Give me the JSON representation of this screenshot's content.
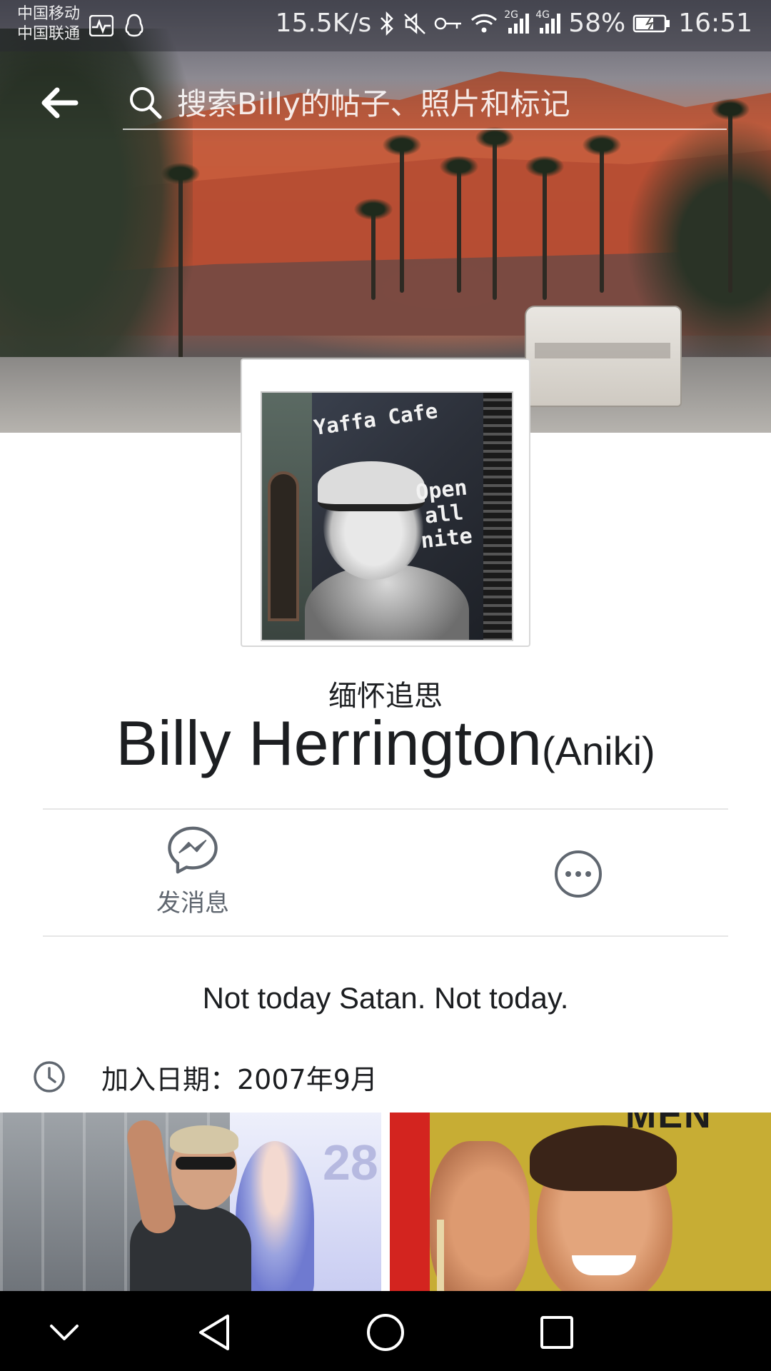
{
  "status_bar": {
    "carrier_1": "中国移动",
    "carrier_2": "中国联通",
    "net_speed": "15.5K/s",
    "signal_1_type": "2G",
    "signal_2_type": "4G",
    "battery": "58%",
    "time": "16:51"
  },
  "search": {
    "placeholder": "搜索Billy的帖子、照片和标记"
  },
  "profile": {
    "memorial_label": "缅怀追思",
    "name": "Billy Herrington",
    "alternate_name": "(Aniki)",
    "picture_text_sign": "Yaffa Cafe",
    "picture_text_hours": "Open all nite",
    "bio": "Not today Satan. Not today.",
    "joined": "加入日期：2007年9月"
  },
  "actions": {
    "message_label": "发消息"
  },
  "photos": {
    "right_title": "MEN"
  },
  "icons": {
    "back": "arrow-left-icon",
    "search": "search-icon",
    "messenger": "messenger-icon",
    "more": "more-options-icon",
    "clock": "clock-icon",
    "nav_down": "chevron-down-icon",
    "nav_back": "triangle-back-icon",
    "nav_home": "circle-home-icon",
    "nav_recent": "square-recent-icon"
  },
  "colors": {
    "text_primary": "#1c1e21",
    "text_secondary": "#606770",
    "icon_gray": "#606770",
    "divider": "#e6e6e6"
  }
}
